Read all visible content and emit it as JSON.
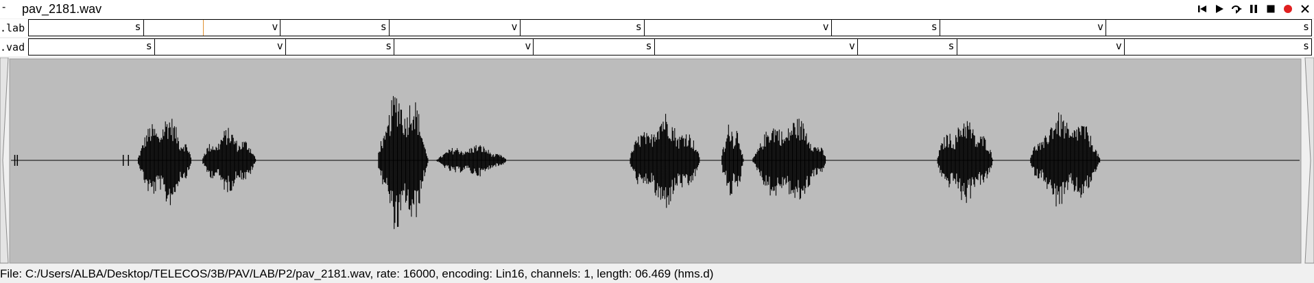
{
  "window": {
    "menu_glyph": "-",
    "title": "pav_2181.wav"
  },
  "toolbar": {
    "buttons": [
      {
        "name": "skip-to-start-icon",
        "symbol": "⏮"
      },
      {
        "name": "play-icon",
        "symbol": "▶"
      },
      {
        "name": "loop-play-icon",
        "symbol": "⟲"
      },
      {
        "name": "pause-icon",
        "symbol": "⏸"
      },
      {
        "name": "stop-icon",
        "symbol": "■"
      },
      {
        "name": "record-icon",
        "symbol": "●"
      },
      {
        "name": "close-icon",
        "symbol": "✕"
      }
    ]
  },
  "tiers": [
    {
      "name": ".lab",
      "segments": [
        {
          "label": "s",
          "end": 0.0896
        },
        {
          "label": "v",
          "end": 0.1965
        },
        {
          "label": "s",
          "end": 0.2812
        },
        {
          "label": "v",
          "end": 0.3832
        },
        {
          "label": "s",
          "end": 0.4801
        },
        {
          "label": "v",
          "end": 0.626
        },
        {
          "label": "s",
          "end": 0.7106
        },
        {
          "label": "v",
          "end": 0.8401
        },
        {
          "label": "s",
          "end": 1.0
        }
      ],
      "cursor": 0.136
    },
    {
      "name": ".vad",
      "segments": [
        {
          "label": "s",
          "end": 0.0983
        },
        {
          "label": "v",
          "end": 0.2004
        },
        {
          "label": "s",
          "end": 0.2851
        },
        {
          "label": "v",
          "end": 0.3938
        },
        {
          "label": "s",
          "end": 0.488
        },
        {
          "label": "v",
          "end": 0.6465
        },
        {
          "label": "s",
          "end": 0.7238
        },
        {
          "label": "v",
          "end": 0.8545
        },
        {
          "label": "s",
          "end": 1.0
        }
      ]
    }
  ],
  "waveform": {
    "background": "#bcbcbc",
    "color": "#000000",
    "bursts": [
      {
        "start": 0.099,
        "end": 0.147,
        "amp": 0.48
      },
      {
        "start": 0.149,
        "end": 0.197,
        "amp": 0.33
      },
      {
        "start": 0.285,
        "end": 0.33,
        "amp": 0.78
      },
      {
        "start": 0.33,
        "end": 0.393,
        "amp": 0.17
      },
      {
        "start": 0.48,
        "end": 0.543,
        "amp": 0.5
      },
      {
        "start": 0.551,
        "end": 0.571,
        "amp": 0.42
      },
      {
        "start": 0.575,
        "end": 0.641,
        "amp": 0.46
      },
      {
        "start": 0.718,
        "end": 0.768,
        "amp": 0.45
      },
      {
        "start": 0.79,
        "end": 0.853,
        "amp": 0.5
      }
    ],
    "clicks": [
      0.004,
      0.006,
      0.088,
      0.092
    ]
  },
  "status": {
    "text": "File: C:/Users/ALBA/Desktop/TELECOS/3B/PAV/LAB/P2/pav_2181.wav, rate: 16000, encoding: Lin16, channels: 1, length: 06.469 (hms.d)"
  },
  "colors": {
    "cursor": "#e09030",
    "record": "#e02020"
  }
}
